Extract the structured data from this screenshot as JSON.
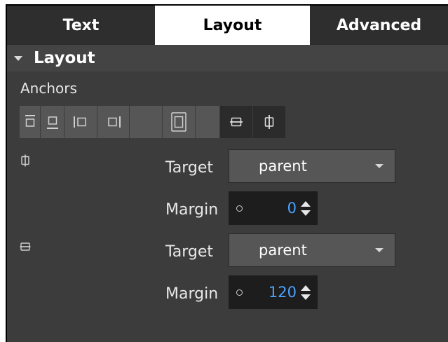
{
  "tabs": [
    {
      "label": "Text"
    },
    {
      "label": "Layout"
    },
    {
      "label": "Advanced"
    }
  ],
  "section": {
    "title": "Layout"
  },
  "anchors": {
    "label": "Anchors",
    "buttons": [
      {
        "icon": "anchor-top-icon"
      },
      {
        "icon": "anchor-bottom-icon"
      },
      {
        "icon": "anchor-left-icon"
      },
      {
        "icon": "anchor-right-icon"
      },
      {
        "icon": "anchor-fill-icon"
      },
      {
        "icon": "anchor-fill-parent-icon"
      },
      {
        "icon": "anchor-blank-icon"
      },
      {
        "icon": "anchor-vertical-center-icon"
      },
      {
        "icon": "anchor-horizontal-center-icon"
      }
    ]
  },
  "horizontal_center": {
    "icon": "horizontal-center-icon",
    "target_label": "Target",
    "target_value": "parent",
    "margin_label": "Margin",
    "margin_value": "0"
  },
  "vertical_center": {
    "icon": "vertical-center-icon",
    "target_label": "Target",
    "target_value": "parent",
    "margin_label": "Margin",
    "margin_value": "120"
  },
  "colors": {
    "panel_bg": "#3c3c3c",
    "active_tab_bg": "#ffffff",
    "inactive_tab_bg": "#2e2e2e",
    "accent_value": "#4aa3ff"
  }
}
